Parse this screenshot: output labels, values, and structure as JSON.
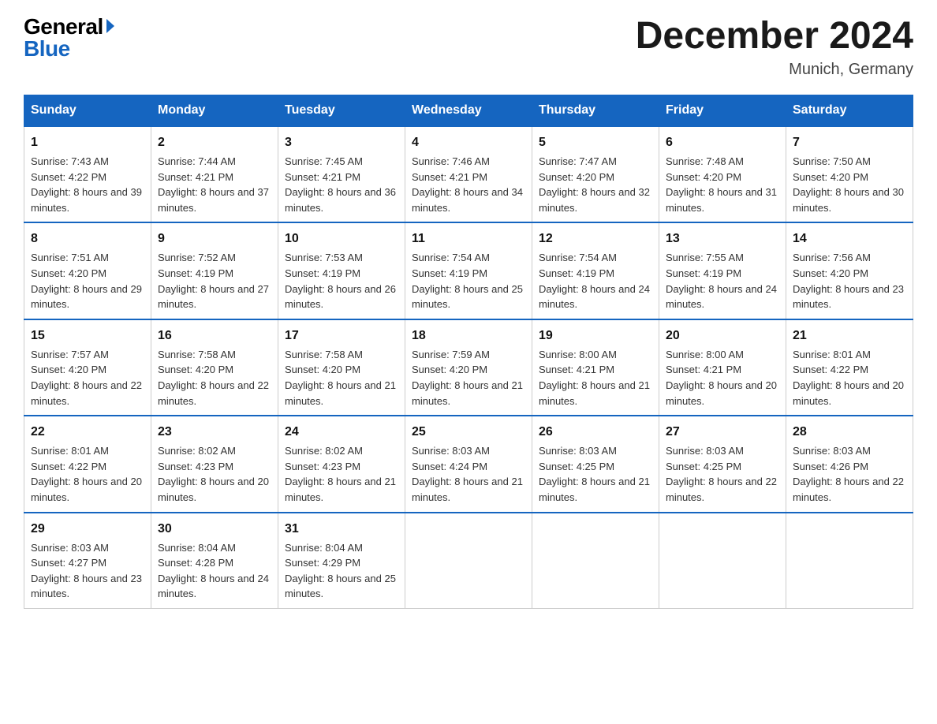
{
  "logo": {
    "general": "General",
    "blue": "Blue"
  },
  "title": "December 2024",
  "location": "Munich, Germany",
  "headers": [
    "Sunday",
    "Monday",
    "Tuesday",
    "Wednesday",
    "Thursday",
    "Friday",
    "Saturday"
  ],
  "weeks": [
    [
      {
        "day": "1",
        "sunrise": "7:43 AM",
        "sunset": "4:22 PM",
        "daylight": "8 hours and 39 minutes."
      },
      {
        "day": "2",
        "sunrise": "7:44 AM",
        "sunset": "4:21 PM",
        "daylight": "8 hours and 37 minutes."
      },
      {
        "day": "3",
        "sunrise": "7:45 AM",
        "sunset": "4:21 PM",
        "daylight": "8 hours and 36 minutes."
      },
      {
        "day": "4",
        "sunrise": "7:46 AM",
        "sunset": "4:21 PM",
        "daylight": "8 hours and 34 minutes."
      },
      {
        "day": "5",
        "sunrise": "7:47 AM",
        "sunset": "4:20 PM",
        "daylight": "8 hours and 32 minutes."
      },
      {
        "day": "6",
        "sunrise": "7:48 AM",
        "sunset": "4:20 PM",
        "daylight": "8 hours and 31 minutes."
      },
      {
        "day": "7",
        "sunrise": "7:50 AM",
        "sunset": "4:20 PM",
        "daylight": "8 hours and 30 minutes."
      }
    ],
    [
      {
        "day": "8",
        "sunrise": "7:51 AM",
        "sunset": "4:20 PM",
        "daylight": "8 hours and 29 minutes."
      },
      {
        "day": "9",
        "sunrise": "7:52 AM",
        "sunset": "4:19 PM",
        "daylight": "8 hours and 27 minutes."
      },
      {
        "day": "10",
        "sunrise": "7:53 AM",
        "sunset": "4:19 PM",
        "daylight": "8 hours and 26 minutes."
      },
      {
        "day": "11",
        "sunrise": "7:54 AM",
        "sunset": "4:19 PM",
        "daylight": "8 hours and 25 minutes."
      },
      {
        "day": "12",
        "sunrise": "7:54 AM",
        "sunset": "4:19 PM",
        "daylight": "8 hours and 24 minutes."
      },
      {
        "day": "13",
        "sunrise": "7:55 AM",
        "sunset": "4:19 PM",
        "daylight": "8 hours and 24 minutes."
      },
      {
        "day": "14",
        "sunrise": "7:56 AM",
        "sunset": "4:20 PM",
        "daylight": "8 hours and 23 minutes."
      }
    ],
    [
      {
        "day": "15",
        "sunrise": "7:57 AM",
        "sunset": "4:20 PM",
        "daylight": "8 hours and 22 minutes."
      },
      {
        "day": "16",
        "sunrise": "7:58 AM",
        "sunset": "4:20 PM",
        "daylight": "8 hours and 22 minutes."
      },
      {
        "day": "17",
        "sunrise": "7:58 AM",
        "sunset": "4:20 PM",
        "daylight": "8 hours and 21 minutes."
      },
      {
        "day": "18",
        "sunrise": "7:59 AM",
        "sunset": "4:20 PM",
        "daylight": "8 hours and 21 minutes."
      },
      {
        "day": "19",
        "sunrise": "8:00 AM",
        "sunset": "4:21 PM",
        "daylight": "8 hours and 21 minutes."
      },
      {
        "day": "20",
        "sunrise": "8:00 AM",
        "sunset": "4:21 PM",
        "daylight": "8 hours and 20 minutes."
      },
      {
        "day": "21",
        "sunrise": "8:01 AM",
        "sunset": "4:22 PM",
        "daylight": "8 hours and 20 minutes."
      }
    ],
    [
      {
        "day": "22",
        "sunrise": "8:01 AM",
        "sunset": "4:22 PM",
        "daylight": "8 hours and 20 minutes."
      },
      {
        "day": "23",
        "sunrise": "8:02 AM",
        "sunset": "4:23 PM",
        "daylight": "8 hours and 20 minutes."
      },
      {
        "day": "24",
        "sunrise": "8:02 AM",
        "sunset": "4:23 PM",
        "daylight": "8 hours and 21 minutes."
      },
      {
        "day": "25",
        "sunrise": "8:03 AM",
        "sunset": "4:24 PM",
        "daylight": "8 hours and 21 minutes."
      },
      {
        "day": "26",
        "sunrise": "8:03 AM",
        "sunset": "4:25 PM",
        "daylight": "8 hours and 21 minutes."
      },
      {
        "day": "27",
        "sunrise": "8:03 AM",
        "sunset": "4:25 PM",
        "daylight": "8 hours and 22 minutes."
      },
      {
        "day": "28",
        "sunrise": "8:03 AM",
        "sunset": "4:26 PM",
        "daylight": "8 hours and 22 minutes."
      }
    ],
    [
      {
        "day": "29",
        "sunrise": "8:03 AM",
        "sunset": "4:27 PM",
        "daylight": "8 hours and 23 minutes."
      },
      {
        "day": "30",
        "sunrise": "8:04 AM",
        "sunset": "4:28 PM",
        "daylight": "8 hours and 24 minutes."
      },
      {
        "day": "31",
        "sunrise": "8:04 AM",
        "sunset": "4:29 PM",
        "daylight": "8 hours and 25 minutes."
      },
      null,
      null,
      null,
      null
    ]
  ]
}
